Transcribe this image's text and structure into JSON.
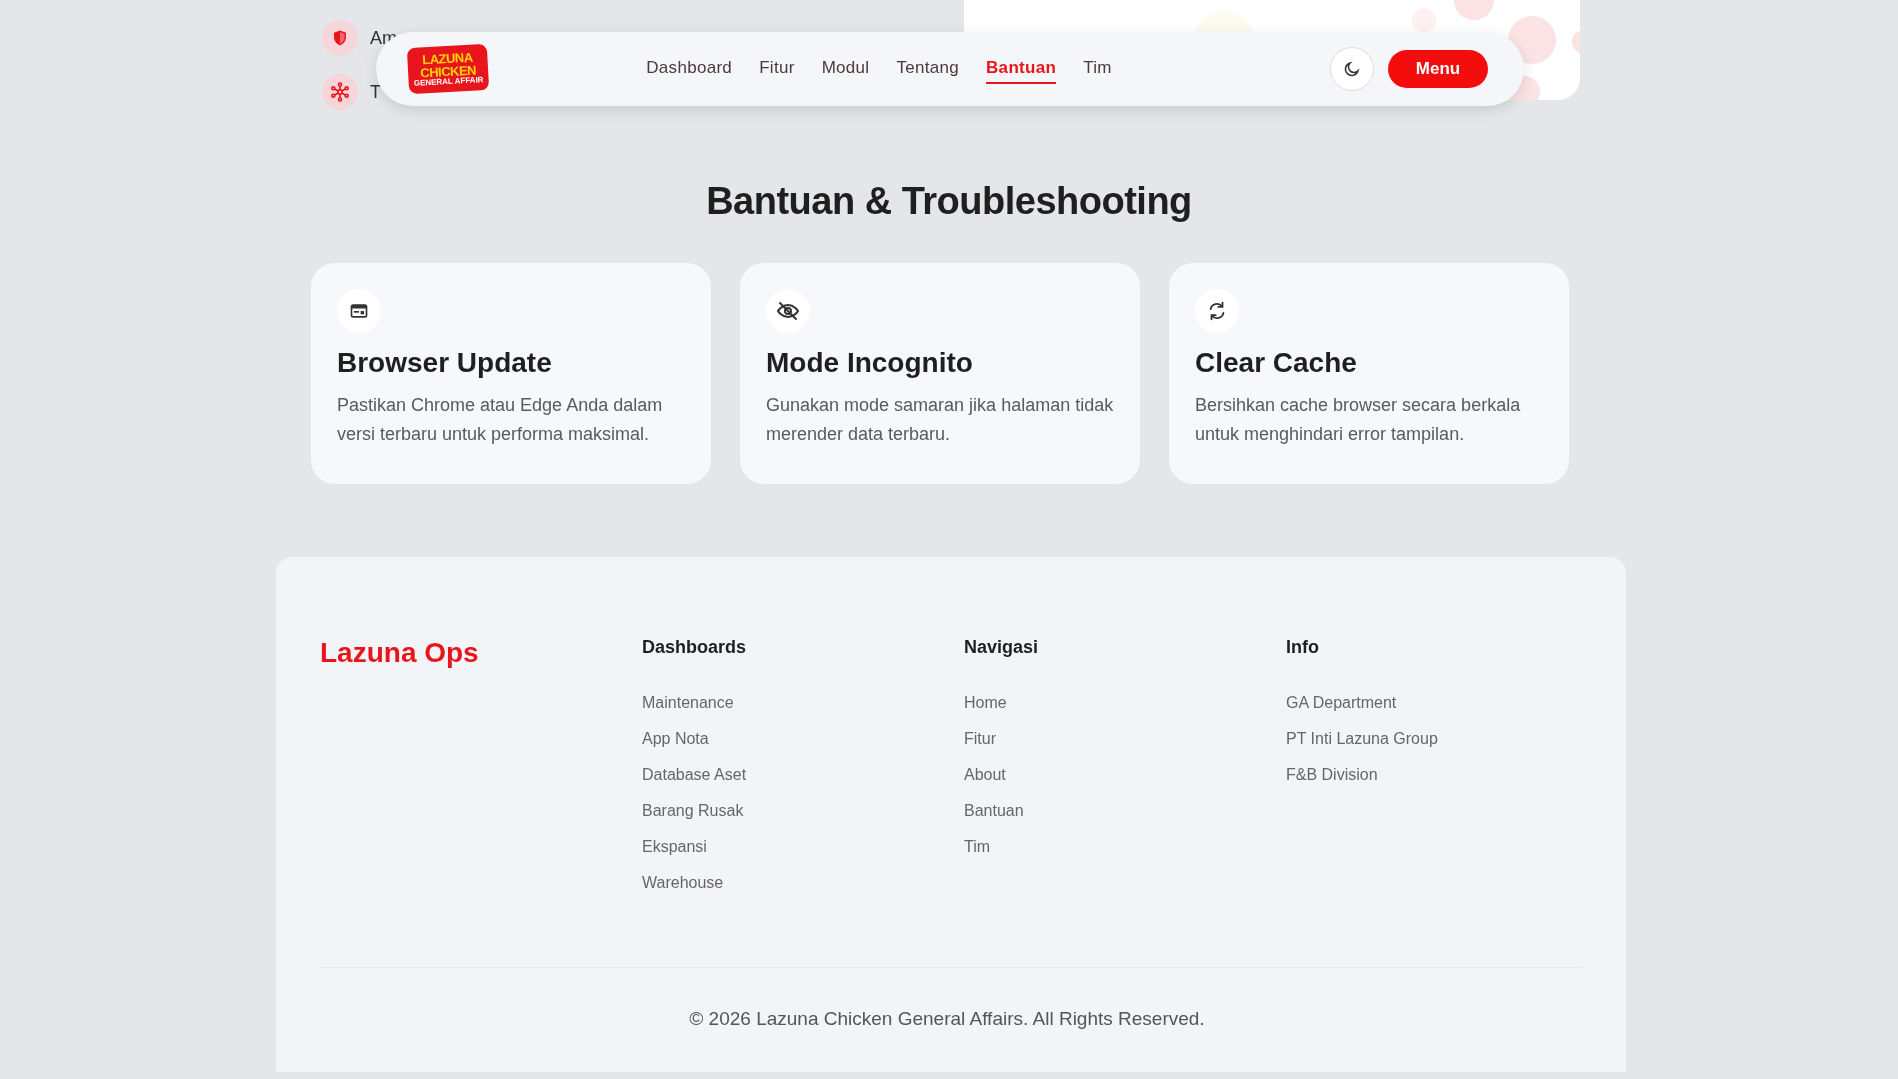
{
  "background_list": [
    {
      "label": "Am",
      "kind": "shield"
    },
    {
      "label": "T",
      "kind": "network"
    }
  ],
  "navbar": {
    "logo": {
      "line_1": "LAZUNA",
      "line_2": "CHICKEN",
      "line_3": "GENERAL AFFAIR"
    },
    "links": [
      {
        "label": "Dashboard",
        "selected": false
      },
      {
        "label": "Fitur",
        "selected": false
      },
      {
        "label": "Modul",
        "selected": false
      },
      {
        "label": "Tentang",
        "selected": false
      },
      {
        "label": "Bantuan",
        "selected": true
      },
      {
        "label": "Tim",
        "selected": false
      }
    ],
    "menu_button": "Menu"
  },
  "section": {
    "title": "Bantuan & Troubleshooting",
    "cards": [
      {
        "kind": "browser",
        "title": "Browser Update",
        "text": "Pastikan Chrome atau Edge Anda dalam versi terbaru untuk performa maksimal."
      },
      {
        "kind": "incognito",
        "title": "Mode Incognito",
        "text": "Gunakan mode samaran jika halaman tidak merender data terbaru."
      },
      {
        "kind": "refresh",
        "title": "Clear Cache",
        "text": "Bersihkan cache browser secara berkala untuk menghindari error tampilan."
      }
    ]
  },
  "footer": {
    "brand": "Lazuna Ops",
    "columns": [
      {
        "heading": "Dashboards",
        "links": [
          "Maintenance",
          "App Nota",
          "Database Aset",
          "Barang Rusak",
          "Ekspansi",
          "Warehouse"
        ]
      },
      {
        "heading": "Navigasi",
        "links": [
          "Home",
          "Fitur",
          "About",
          "Bantuan",
          "Tim"
        ]
      },
      {
        "heading": "Info",
        "links": [
          "GA Department",
          "PT Inti Lazuna Group",
          "F&B Division"
        ]
      }
    ],
    "copyright": "© 2026 Lazuna Chicken General Affairs. All Rights Reserved."
  }
}
